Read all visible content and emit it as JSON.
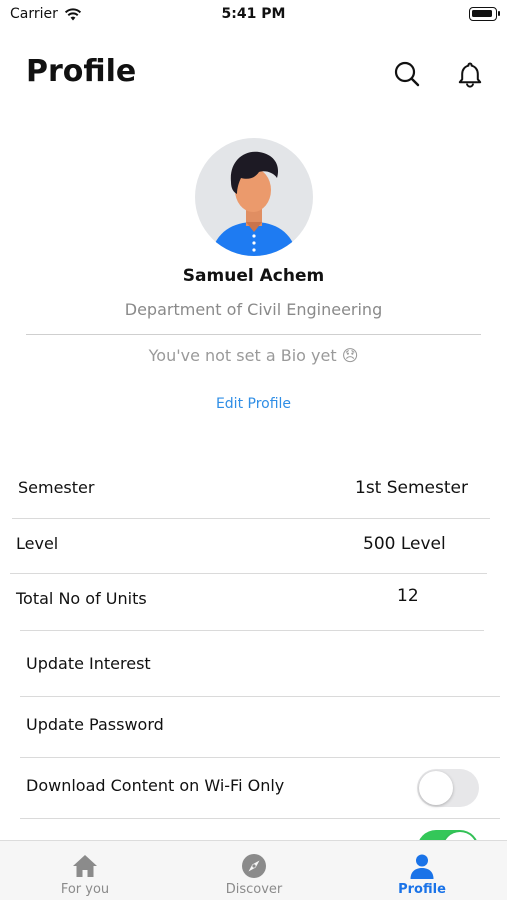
{
  "status_bar": {
    "carrier": "Carrier",
    "time": "5:41 PM"
  },
  "header": {
    "title": "Profile"
  },
  "profile": {
    "name": "Samuel Achem",
    "department": "Department of Civil Engineering",
    "bio": "You've not set a Bio yet 😞",
    "edit_label": "Edit Profile"
  },
  "details": [
    {
      "label": "Semester",
      "value": "1st Semester"
    },
    {
      "label": "Level",
      "value": "500 Level"
    },
    {
      "label": "Total No of Units",
      "value": "12"
    }
  ],
  "settings": {
    "update_interest": "Update Interest",
    "update_password": "Update Password",
    "download_wifi": "Download Content on Wi-Fi Only",
    "download_wifi_on": false,
    "next_toggle_on": true
  },
  "tabs": [
    {
      "label": "For you",
      "icon": "home-icon"
    },
    {
      "label": "Discover",
      "icon": "compass-icon"
    },
    {
      "label": "Profile",
      "icon": "person-icon",
      "active": true
    }
  ],
  "colors": {
    "accent": "#1a73e8",
    "link": "#2f8ee6",
    "toggle_on": "#34c759"
  }
}
